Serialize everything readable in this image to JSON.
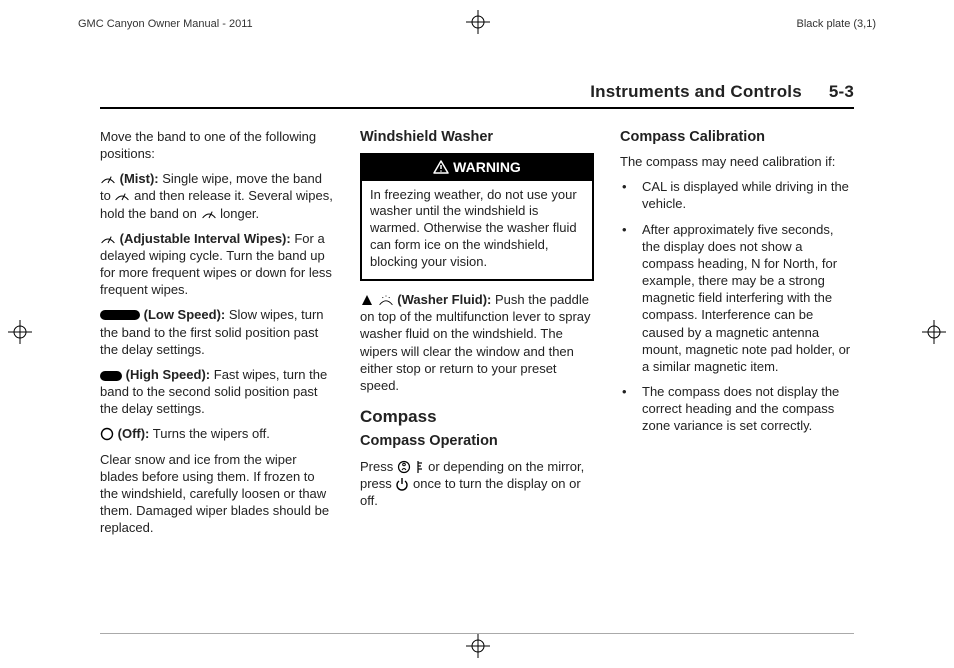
{
  "header": {
    "left": "GMC Canyon Owner Manual - 2011",
    "right": "Black plate (3,1)"
  },
  "running_head": {
    "section": "Instruments and Controls",
    "page": "5-3"
  },
  "col1": {
    "intro": "Move the band to one of the following positions:",
    "mist_label": "(Mist):",
    "mist_text_a": "Single wipe, move the band to",
    "mist_text_b": "and then release it. Several wipes, hold the band on",
    "mist_text_c": "longer.",
    "adj_label": "(Adjustable Interval Wipes):",
    "adj_text": "For a delayed wiping cycle. Turn the band up for more frequent wipes or down for less frequent wipes.",
    "low_label": "(Low Speed):",
    "low_text": "Slow wipes, turn the band to the first solid position past the delay settings.",
    "high_label": "(High Speed):",
    "high_text": "Fast wipes, turn the band to the second solid position past the delay settings.",
    "off_label": "(Off):",
    "off_text": "Turns the wipers off.",
    "tail": "Clear snow and ice from the wiper blades before using them. If frozen to the windshield, carefully loosen or thaw them. Damaged wiper blades should be replaced."
  },
  "col2": {
    "h_washer": "Windshield Washer",
    "warn_title": "WARNING",
    "warn_body": "In freezing weather, do not use your washer until the windshield is warmed. Otherwise the washer fluid can form ice on the windshield, blocking your vision.",
    "fluid_label": "(Washer Fluid):",
    "fluid_text": "Push the paddle on top of the multifunction lever to spray washer fluid on the windshield. The wipers will clear the window and then either stop or return to your preset speed.",
    "h_compass": "Compass",
    "h_op": "Compass Operation",
    "op_a": "Press",
    "op_b": "or depending on the mirror, press",
    "op_c": "once to turn the display on or off."
  },
  "col3": {
    "h_cal": "Compass Calibration",
    "intro": "The compass may need calibration if:",
    "b1": "CAL is displayed while driving in the vehicle.",
    "b2": "After approximately five seconds, the display does not show a compass heading, N for North, for example, there may be a strong magnetic field interfering with the compass. Interference can be caused by a magnetic antenna mount, magnetic note pad holder, or a similar magnetic item.",
    "b3": "The compass does not display the correct heading and the compass zone variance is set correctly."
  }
}
